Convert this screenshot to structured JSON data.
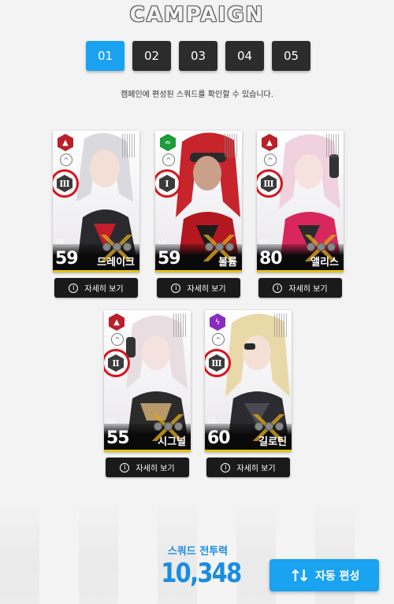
{
  "header": {
    "title": "CAMPAIGN"
  },
  "tabs": [
    {
      "label": "01",
      "active": true
    },
    {
      "label": "02",
      "active": false
    },
    {
      "label": "03",
      "active": false
    },
    {
      "label": "04",
      "active": false
    },
    {
      "label": "05",
      "active": false
    }
  ],
  "subtitle": "캠페인에 편성된 스쿼드를 확인할 수 있습니다.",
  "squad": [
    {
      "name": "드레이크",
      "lv_label": "LV.",
      "level": "59",
      "element": "fire",
      "element_icon": "flame-icon",
      "weapon_grade": "Ⅲ",
      "stars": 3,
      "hair": "#d9d9de",
      "accent": "#c21f2a",
      "detail_label": "자세히 보기"
    },
    {
      "name": "볼륨",
      "lv_label": "LV.",
      "level": "59",
      "element": "wind",
      "element_icon": "wind-icon",
      "weapon_grade": "Ⅰ",
      "stars": 3,
      "hair": "#c7242c",
      "accent": "#b3171f",
      "detail_label": "자세히 보기"
    },
    {
      "name": "앨리스",
      "lv_label": "LV.",
      "level": "80",
      "element": "fire",
      "element_icon": "flame-icon",
      "weapon_grade": "Ⅲ",
      "stars": 3,
      "hair": "#efd2de",
      "accent": "#d8275c",
      "detail_label": "자세히 보기"
    },
    {
      "name": "시그널",
      "lv_label": "LV.",
      "level": "55",
      "element": "fire",
      "element_icon": "flame-icon",
      "weapon_grade": "Ⅱ",
      "stars": 3,
      "hair": "#e8dde0",
      "accent": "#2b2b2b",
      "detail_label": "자세히 보기"
    },
    {
      "name": "길로틴",
      "lv_label": "LV.",
      "level": "60",
      "element": "electric",
      "element_icon": "lightning-icon",
      "weapon_grade": "Ⅲ",
      "stars": 3,
      "hair": "#e9d8a8",
      "accent": "#2c2c30",
      "detail_label": "자세히 보기"
    }
  ],
  "footer": {
    "power_label": "스쿼드 전투력",
    "power_value": "10,348",
    "auto_button_label": "자동 편성"
  },
  "colors": {
    "accent": "#1aa3f0",
    "power": "#1a8ce0",
    "weapon_ring": "#d6141e"
  }
}
